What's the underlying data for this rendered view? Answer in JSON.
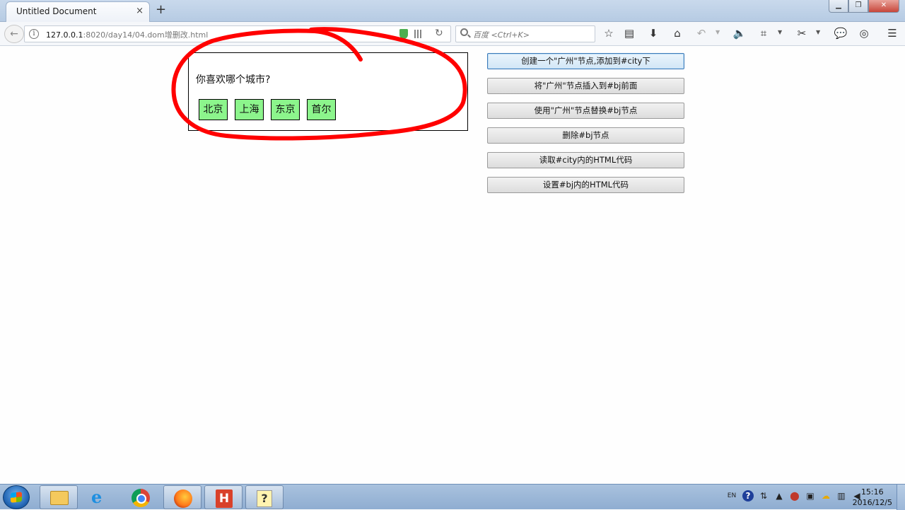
{
  "browser": {
    "tab_title": "Untitled Document",
    "tab_close": "×",
    "new_tab": "+",
    "url_host": "127.0.0.1",
    "url_path": ":8020/day14/04.dom增删改.html",
    "search_placeholder": "百度 <Ctrl+K>"
  },
  "page": {
    "question": "你喜欢哪个城市?",
    "cities": [
      "北京",
      "上海",
      "东京",
      "首尔"
    ],
    "buttons": [
      "创建一个\"广州\"节点,添加到#city下",
      "将\"广州\"节点插入到#bj前面",
      "使用\"广州\"节点替换#bj节点",
      "删除#bj节点",
      "读取#city内的HTML代码",
      "设置#bj内的HTML代码"
    ]
  },
  "taskbar": {
    "apps": [
      "file-explorer",
      "internet-explorer",
      "chrome",
      "firefox",
      "hbuilder",
      "help"
    ],
    "active_app": "firefox",
    "tray_lang": "EN",
    "clock_time": "15:16",
    "clock_date": "2016/12/5"
  },
  "colors": {
    "city_bg": "#8cf58c",
    "annotation": "#ff0000"
  }
}
